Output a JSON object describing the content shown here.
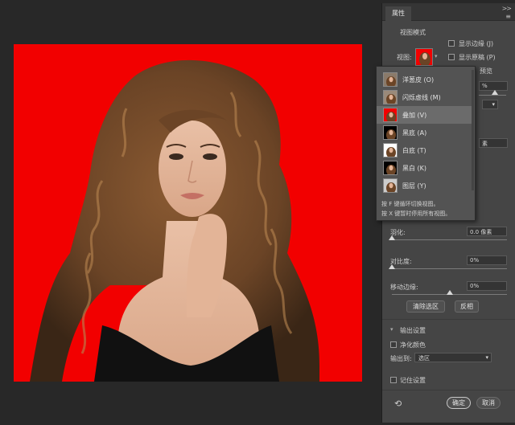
{
  "panel": {
    "tab_label": "属性",
    "collapse_icon": ">>",
    "menu_icon": "≡",
    "view_mode": {
      "title": "视图模式",
      "view_label": "视图:",
      "show_edge_label": "显示边缘 (J)",
      "show_original_label": "显示原稿 (P)",
      "hq_preview_partial": "预览"
    },
    "partial_values": {
      "value_1": "%",
      "value_2": "素"
    },
    "feather": {
      "label": "羽化:",
      "value": "0.0 像素",
      "level": 0
    },
    "contrast": {
      "label": "对比度:",
      "value": "0%",
      "level": 0
    },
    "shift_edge": {
      "label": "移动边缘:",
      "value": "0%",
      "level": 0.5
    },
    "buttons": {
      "clear_selection": "清除选区",
      "invert": "反相"
    },
    "output": {
      "section_title": "输出设置",
      "decontaminate_label": "净化颜色",
      "output_to_label": "输出到:",
      "output_to_value": "选区"
    },
    "remember_label": "记住设置",
    "ok_label": "确定",
    "cancel_label": "取消",
    "reset_icon": "reset-icon"
  },
  "dropdown": {
    "items": [
      {
        "label": "洋葱皮 (O)",
        "thumb_bg": "#8a7a6a"
      },
      {
        "label": "闪烁虚线 (M)",
        "thumb_bg": "#9a8a7a"
      },
      {
        "label": "叠加 (V)",
        "thumb_bg": "#f20000"
      },
      {
        "label": "黑底 (A)",
        "thumb_bg": "#000000"
      },
      {
        "label": "白底 (T)",
        "thumb_bg": "#ffffff"
      },
      {
        "label": "黑白 (K)",
        "thumb_bg": "#000000"
      },
      {
        "label": "图层 (Y)",
        "thumb_bg": "#cccccc"
      }
    ],
    "selected_index": 2,
    "notes": [
      "按 F 键循环切换视图。",
      "按 X 键暂时停用所有视图。"
    ]
  },
  "colors": {
    "overlay_red": "#f20000",
    "panel_bg": "#454545",
    "app_bg": "#282828"
  }
}
